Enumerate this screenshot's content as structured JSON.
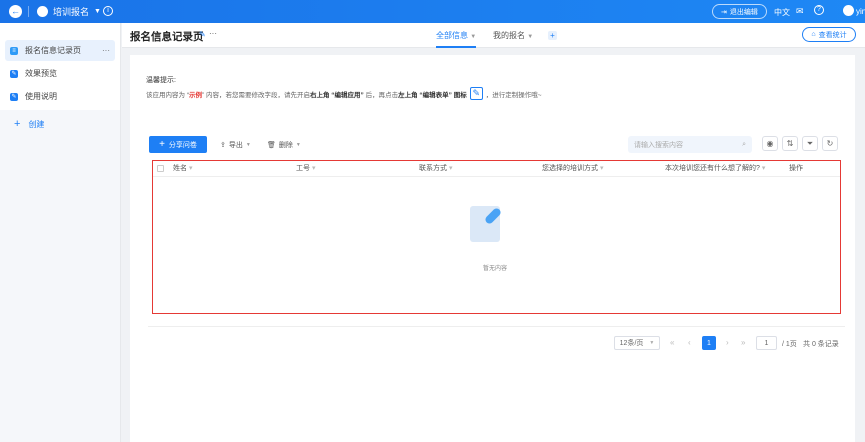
{
  "topbar": {
    "app_name": "培训报名",
    "exit_edit": "退出编辑",
    "language": "中文",
    "user": "yin"
  },
  "sidebar": {
    "items": [
      {
        "label": "报名信息记录页",
        "active": true
      },
      {
        "label": "效果预览"
      },
      {
        "label": "使用说明"
      }
    ],
    "create": "创建"
  },
  "header": {
    "page_title": "报名信息记录页",
    "tabs": [
      {
        "label": "全部信息",
        "active": true
      },
      {
        "label": "我的报名"
      }
    ],
    "stats_button": "查看统计"
  },
  "tip": {
    "title": "温馨提示:",
    "t1": "该应用内容为 “",
    "t2": "示例",
    "t3": "” 内容，若您需要修改字段，请先开启",
    "t4": "右上角 “编辑应用”",
    "t5": " 后，再点击",
    "t6": "左上角 “编辑表单” 图标",
    "t7": "，进行定制操作哦~"
  },
  "toolbar": {
    "share": "分享问卷",
    "export": "导出",
    "delete": "删除",
    "search_placeholder": "请输入搜索内容"
  },
  "table": {
    "columns": [
      "姓名",
      "工号",
      "联系方式",
      "您选择的培训方式",
      "本次培训您还有什么想了解的?",
      "操作"
    ],
    "empty": "暂无内容"
  },
  "pagination": {
    "page_size": "12条/页",
    "current": "1",
    "jump": "1",
    "total_pages": "/ 1页",
    "total": "共 0 条记录"
  },
  "colors": {
    "primary": "#1e7ff5",
    "highlight": "#e53935"
  }
}
